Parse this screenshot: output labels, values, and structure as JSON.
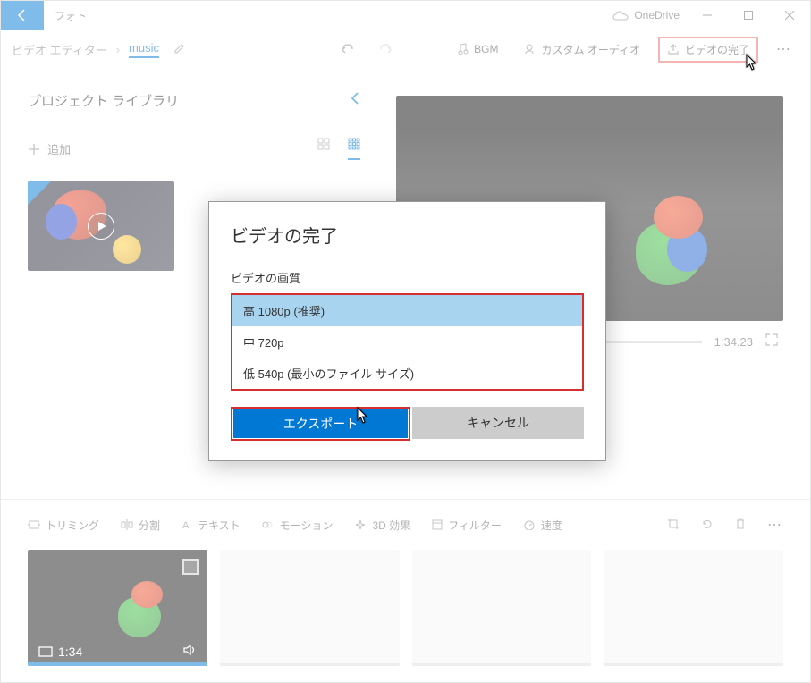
{
  "titlebar": {
    "app_name": "フォト",
    "onedrive": "OneDrive"
  },
  "breadcrumb": {
    "root": "ビデオ エディター",
    "current": "music"
  },
  "toolbar": {
    "bgm": "BGM",
    "custom_audio": "カスタム オーディオ",
    "finish": "ビデオの完了"
  },
  "sidebar": {
    "title": "プロジェクト ライブラリ",
    "add": "追加"
  },
  "timeline": {
    "time": "1:34.23"
  },
  "bottom_tools": {
    "trimming": "トリミング",
    "split": "分割",
    "text": "テキスト",
    "motion": "モーション",
    "effect3d": "3D 効果",
    "filter": "フィルター",
    "speed": "速度"
  },
  "clip": {
    "duration": "1:34"
  },
  "dialog": {
    "title": "ビデオの完了",
    "quality_label": "ビデオの画質",
    "options": {
      "high": "高 1080p (推奨)",
      "medium": "中 720p",
      "low": "低 540p (最小のファイル サイズ)"
    },
    "export": "エクスポート",
    "cancel": "キャンセル"
  }
}
